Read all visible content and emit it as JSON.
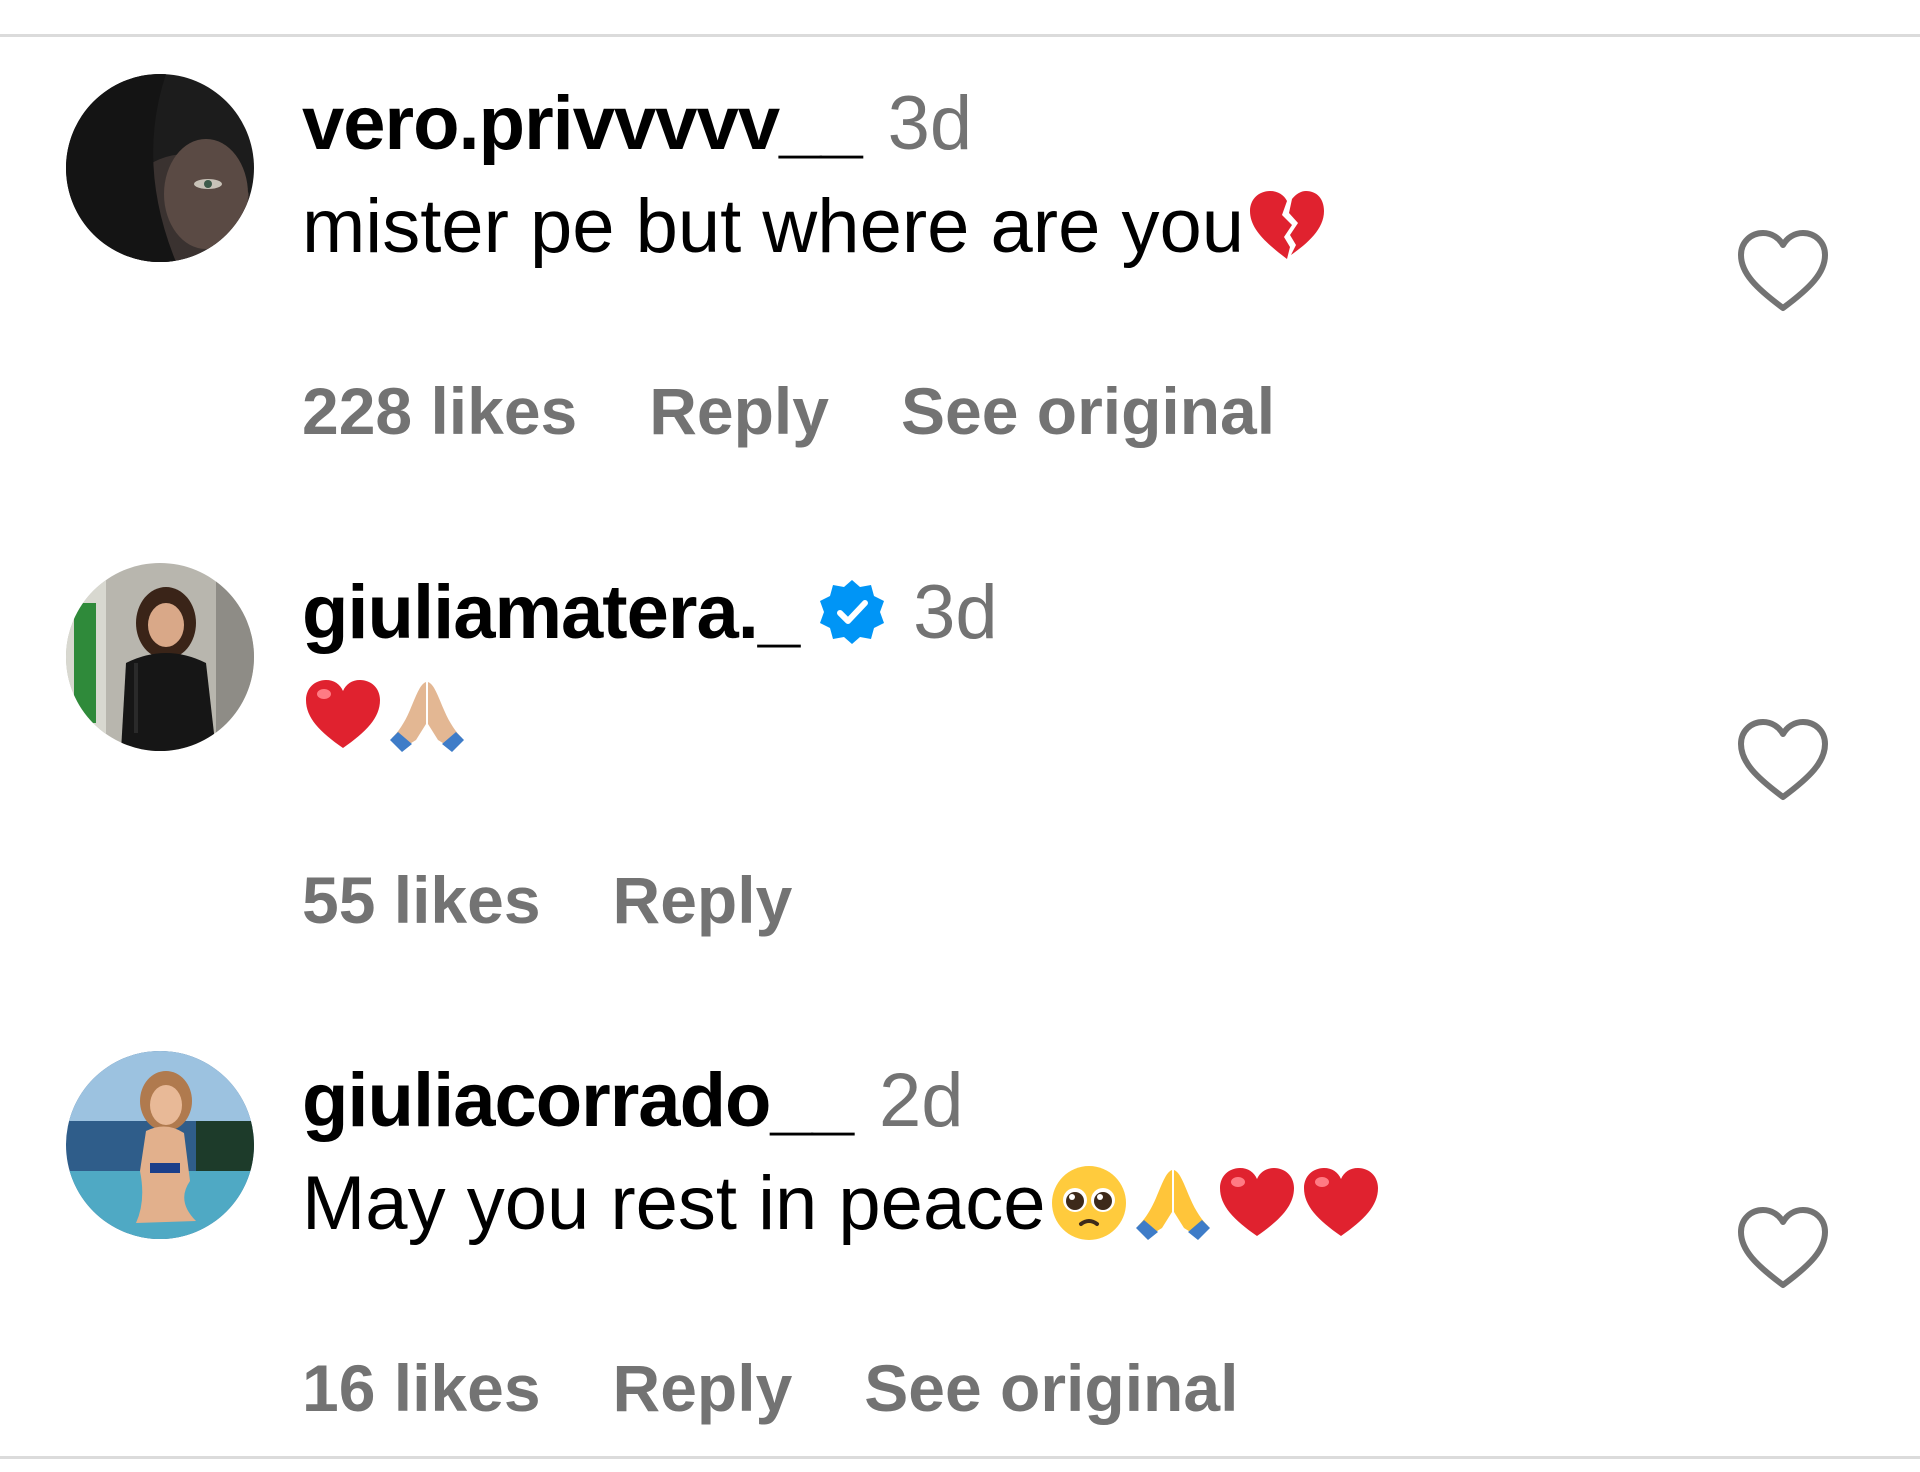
{
  "comments": [
    {
      "username": "vero.privvvvv__",
      "verified": false,
      "time": "3d",
      "text": "mister pe but where are you",
      "emojis": [
        "broken-heart-icon"
      ],
      "likes": "228 likes",
      "reply": "Reply",
      "see_original": "See original"
    },
    {
      "username": "giuliamatera._",
      "verified": true,
      "time": "3d",
      "text": "",
      "emojis": [
        "red-heart-icon",
        "folded-hands-light-icon"
      ],
      "likes": "55 likes",
      "reply": "Reply",
      "see_original": ""
    },
    {
      "username": "giuliacorrado__",
      "verified": false,
      "time": "2d",
      "text": "May you rest in peace",
      "emojis": [
        "pleading-face-icon",
        "folded-hands-icon",
        "red-heart-icon",
        "red-heart-icon"
      ],
      "likes": "16 likes",
      "reply": "Reply",
      "see_original": "See original"
    }
  ],
  "colors": {
    "text": "#000000",
    "secondary": "#737373",
    "divider": "#dbdbdb",
    "verified_blue": "#0095f6",
    "heart_red": "#e0222f"
  }
}
